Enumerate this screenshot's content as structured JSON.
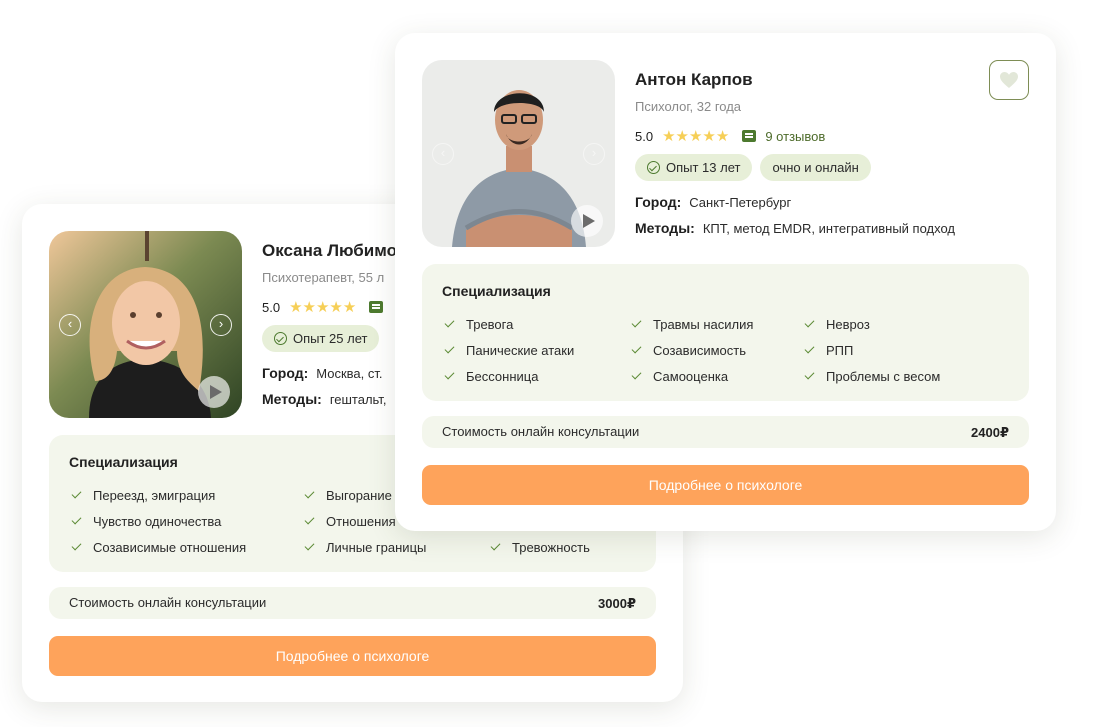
{
  "cards": [
    {
      "name": "Оксана Любимо",
      "role": "Психотерапевт, 55 л",
      "rating": "5.0",
      "stars": "★★★★★",
      "reviews_text": "",
      "tags": [
        "Опыт 25 лет"
      ],
      "city_label": "Город:",
      "city_value": "Москва, ст.",
      "methods_label": "Методы:",
      "methods_value": "гештальт,",
      "spec_title": "Специализация",
      "specializations": [
        "Переезд, эмиграция",
        "Чувство одиночества",
        "Созависимые отношения",
        "Выгорание",
        "Отношения",
        "Личные границы",
        "Тревожность"
      ],
      "price_label": "Стоимость онлайн консультации",
      "price_value": "3000₽",
      "cta": "Подробнее о психологе",
      "icons": {
        "nav_left": "chevron-left-icon",
        "nav_right": "chevron-right-icon",
        "play": "play-icon",
        "reviews": "chat-icon",
        "check": "check-icon"
      }
    },
    {
      "name": "Антон Карпов",
      "role": "Психолог, 32 года",
      "rating": "5.0",
      "stars": "★★★★★",
      "reviews_text": "9 отзывов",
      "tags": [
        "Опыт 13 лет",
        "очно и онлайн"
      ],
      "city_label": "Город:",
      "city_value": "Санкт-Петербург",
      "methods_label": "Методы:",
      "methods_value": "КПТ, метод EMDR, интегративный подход",
      "spec_title": "Специализация",
      "specializations": [
        "Тревога",
        "Панические атаки",
        "Бессонница",
        "Травмы насилия",
        "Созависимость",
        "Самооценка",
        "Невроз",
        "РПП",
        "Проблемы с весом"
      ],
      "price_label": "Стоимость онлайн консультации",
      "price_value": "2400₽",
      "cta": "Подробнее о психологе",
      "icons": {
        "favorite": "heart-icon",
        "nav_left": "chevron-left-icon",
        "nav_right": "chevron-right-icon",
        "play": "play-icon",
        "reviews": "chat-icon",
        "check": "check-icon"
      }
    }
  ],
  "colors": {
    "accent_orange": "#fea35b",
    "soft_green": "#f3f6ec",
    "tag_green": "#e7efd8",
    "brand_green": "#4d7a2f",
    "star_yellow": "#f6cf57"
  }
}
